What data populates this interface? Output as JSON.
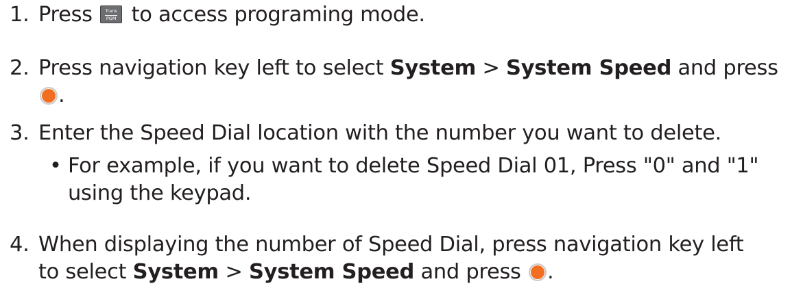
{
  "steps": [
    {
      "number": "1.",
      "pre": "Press",
      "key_label_top": "Trans",
      "key_label_bottom": "PGM",
      "post": "to access programing mode."
    },
    {
      "number": "2.",
      "pre": "Press navigation key left to select",
      "bold1": "System",
      "sep": ">",
      "bold2": "System Speed",
      "post": "and press",
      "end": "."
    },
    {
      "number": "3.",
      "text": "Enter the Speed Dial location with the number you want to delete.",
      "bullet": "•",
      "sub_line1": "For example, if you want to delete Speed Dial 01, Press \"0\" and \"1\"",
      "sub_line2": "using the keypad."
    },
    {
      "number": "4.",
      "line1": "When displaying the number of Speed Dial, press navigation key left",
      "pre": "to select",
      "bold1": "System",
      "sep": ">",
      "bold2": "System Speed",
      "post": "and press",
      "end": "."
    }
  ],
  "icons": {
    "key": "trans-pgm-key-icon",
    "ok": "ok-button-icon"
  },
  "colors": {
    "text": "#231f20",
    "ok_button": "#f26f21",
    "key": "#6d6e71"
  }
}
